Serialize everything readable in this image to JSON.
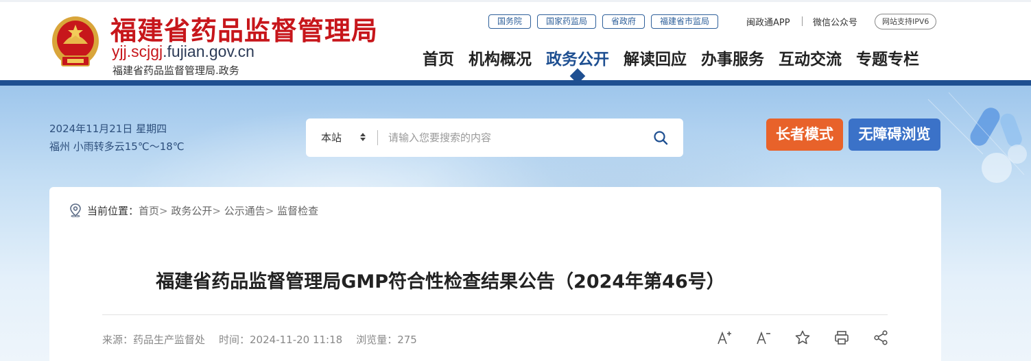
{
  "header": {
    "title": "福建省药品监督管理局",
    "domain_prefix": "yjj.scjgj",
    "domain_suffix": ".fujian.gov.cn",
    "subtitle": "福建省药品监督管理局.政务",
    "quick_links": [
      "国务院",
      "国家药监局",
      "省政府",
      "福建省市监局"
    ],
    "app_link": "闽政通APP",
    "wechat_link": "微信公众号",
    "ipv6": "网站支持IPV6",
    "nav": [
      "首页",
      "机构概况",
      "政务公开",
      "解读回应",
      "办事服务",
      "互动交流",
      "专题专栏"
    ],
    "active_nav": "政务公开"
  },
  "banner": {
    "date": "2024年11月21日 星期四",
    "weather": "福州 小雨转多云15℃～18℃",
    "search": {
      "scope": "本站",
      "placeholder": "请输入您要搜索的内容"
    },
    "elder_mode": "长者模式",
    "accessible": "无障碍浏览"
  },
  "breadcrumb": {
    "label": "当前位置：",
    "items": [
      "首页",
      "政务公开",
      "公示通告",
      "监督检查"
    ]
  },
  "article": {
    "title": "福建省药品监督管理局GMP符合性检查结果公告（2024年第46号）",
    "source": "来源：药品生产监督处",
    "time": "时间：2024-11-20 11:18",
    "views": "浏览量：275"
  },
  "icons": {
    "emblem": "national-emblem-icon",
    "search": "search-icon",
    "location": "location-pin-icon",
    "font_up": "font-increase-icon",
    "font_down": "font-decrease-icon",
    "favorite": "star-icon",
    "print": "print-icon",
    "share": "share-icon"
  },
  "colors": {
    "brand_red": "#c7161b",
    "brand_blue": "#1e4f91",
    "elder_orange": "#e8622a",
    "access_blue": "#3b72c8"
  }
}
